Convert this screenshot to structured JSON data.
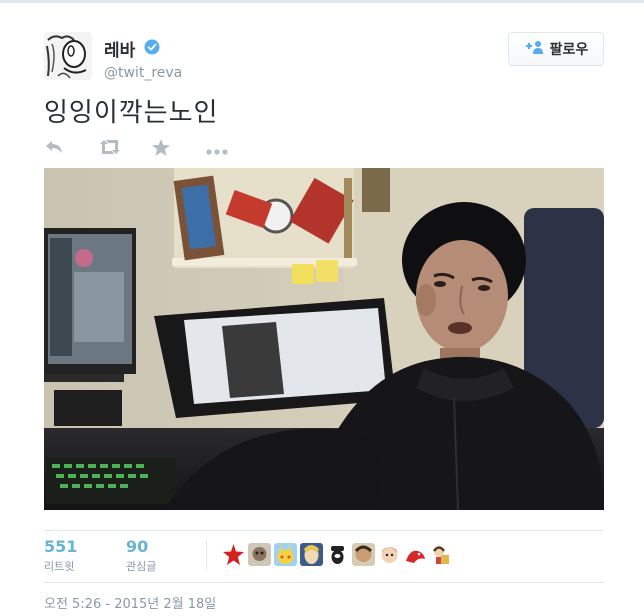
{
  "user": {
    "display_name": "레바",
    "handle": "@twit_reva",
    "verified": true
  },
  "follow_button": {
    "label": "팔로우",
    "icon": "add-user-icon"
  },
  "tweet": {
    "text": "잉잉이깍는노인"
  },
  "actions": [
    {
      "icon": "reply-icon"
    },
    {
      "icon": "retweet-icon"
    },
    {
      "icon": "favorite-star-icon"
    },
    {
      "icon": "more-icon"
    }
  ],
  "stats": {
    "retweets": {
      "count": "551",
      "label": "리트윗"
    },
    "favorites": {
      "count": "90",
      "label": "관심글"
    }
  },
  "favoriters_count_shown": 10,
  "timestamp": "오전 5:26 - 2015년 2월 18일",
  "colors": {
    "accent": "#66b5d2",
    "muted": "#8899a6",
    "text": "#292f33",
    "verified": "#55acee",
    "border": "#e1e8ed"
  }
}
